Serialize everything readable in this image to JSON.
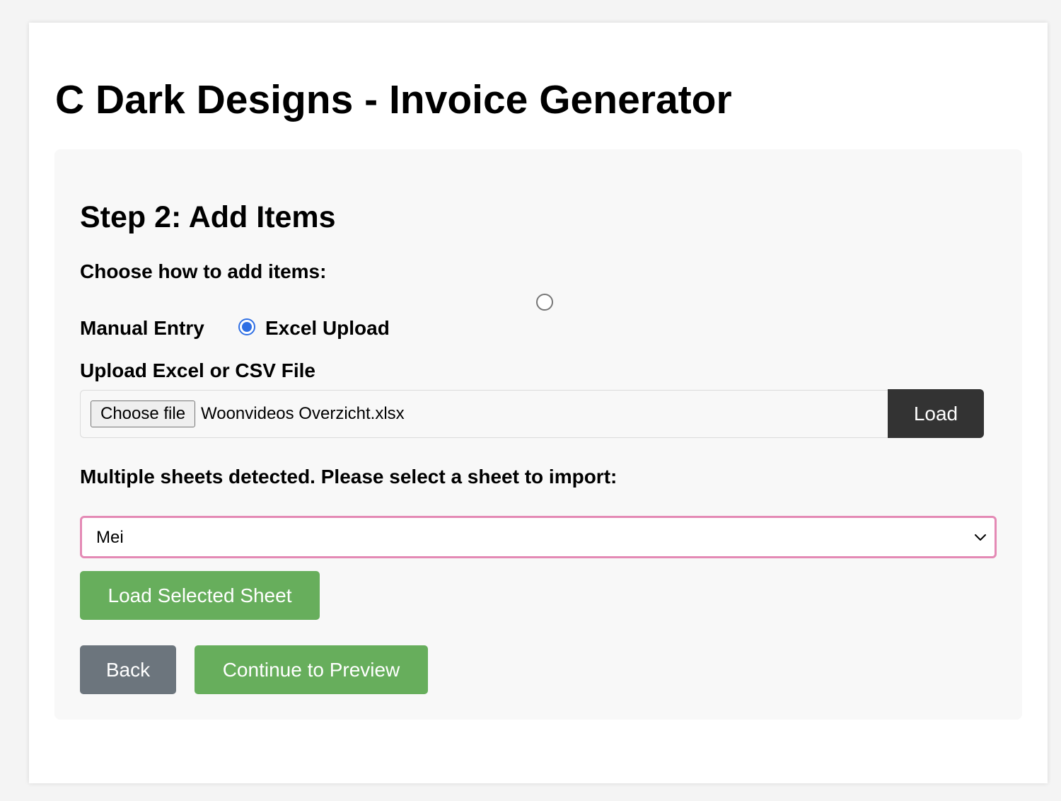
{
  "app": {
    "title": "C Dark Designs - Invoice Generator"
  },
  "step": {
    "title": "Step 2: Add Items",
    "choose_label": "Choose how to add items:",
    "options": [
      {
        "label": "Manual Entry",
        "selected": false
      },
      {
        "label": "Excel Upload",
        "selected": true
      }
    ]
  },
  "upload": {
    "label": "Upload Excel or CSV File",
    "choose_button": "Choose file",
    "file_name": "Woonvideos Overzicht.xlsx",
    "load_button": "Load"
  },
  "sheets": {
    "label": "Multiple sheets detected. Please select a sheet to import:",
    "selected": "Mei",
    "load_button": "Load Selected Sheet"
  },
  "actions": {
    "back": "Back",
    "continue": "Continue to Preview"
  },
  "colors": {
    "accent_green": "#67ae5c",
    "back_gray": "#6c757d",
    "load_dark": "#333333",
    "select_focus": "#e48ab5",
    "radio_blue": "#2f6fe4"
  }
}
